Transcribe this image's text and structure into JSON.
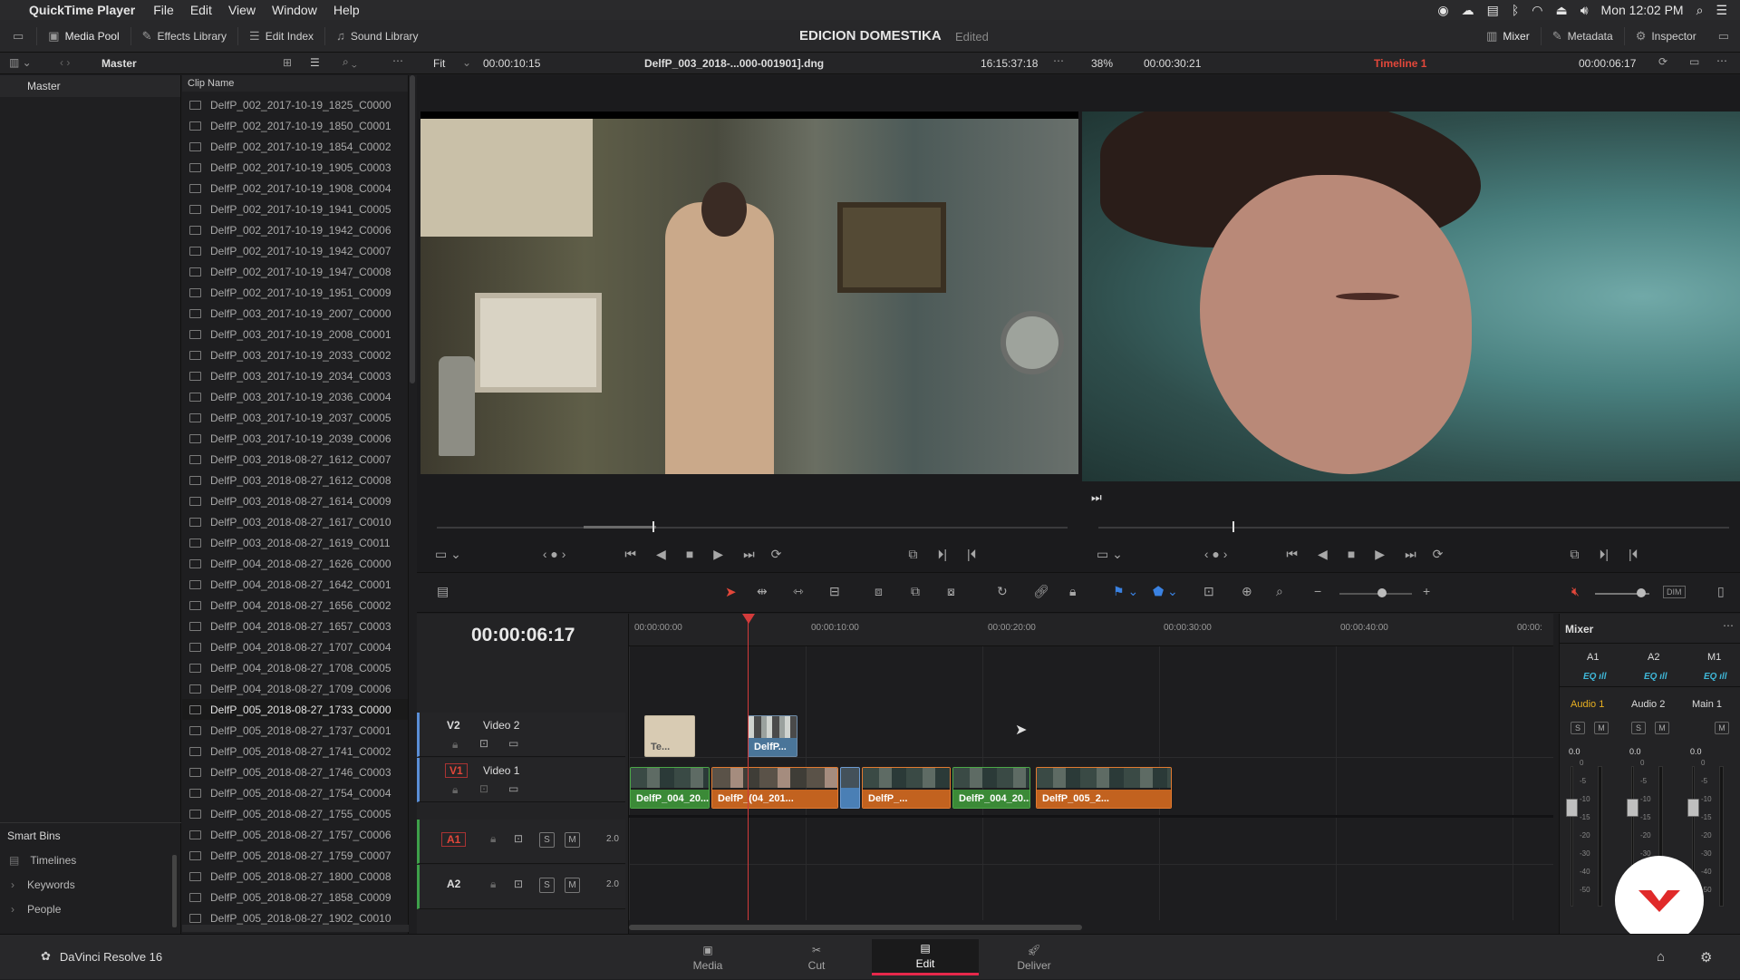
{
  "menubar": {
    "app": "QuickTime Player",
    "items": [
      "File",
      "Edit",
      "View",
      "Window",
      "Help"
    ],
    "clock": "Mon 12:02 PM"
  },
  "toolbar": {
    "media_pool": "Media Pool",
    "effects_library": "Effects Library",
    "edit_index": "Edit Index",
    "sound_library": "Sound Library",
    "project_title": "EDICION DOMESTIKA",
    "project_status": "Edited",
    "mixer": "Mixer",
    "metadata": "Metadata",
    "inspector": "Inspector"
  },
  "subbar": {
    "bin_title": "Master",
    "fit": "Fit",
    "source_tc": "00:00:10:15",
    "clip_name": "DelfP_003_2018-...000-001901].dng",
    "source_time": "16:15:37:18",
    "zoom": "38%",
    "timeline_dur": "00:00:30:21",
    "timeline_name": "Timeline 1",
    "timeline_tc": "00:00:06:17"
  },
  "sidebar": {
    "master": "Master",
    "smart_bins": "Smart Bins",
    "items": [
      "Timelines",
      "Keywords",
      "People"
    ]
  },
  "clip_list": {
    "header": "Clip Name",
    "selected_index": 29,
    "items": [
      "DelfP_002_2017-10-19_1825_C0000",
      "DelfP_002_2017-10-19_1850_C0001",
      "DelfP_002_2017-10-19_1854_C0002",
      "DelfP_002_2017-10-19_1905_C0003",
      "DelfP_002_2017-10-19_1908_C0004",
      "DelfP_002_2017-10-19_1941_C0005",
      "DelfP_002_2017-10-19_1942_C0006",
      "DelfP_002_2017-10-19_1942_C0007",
      "DelfP_002_2017-10-19_1947_C0008",
      "DelfP_002_2017-10-19_1951_C0009",
      "DelfP_003_2017-10-19_2007_C0000",
      "DelfP_003_2017-10-19_2008_C0001",
      "DelfP_003_2017-10-19_2033_C0002",
      "DelfP_003_2017-10-19_2034_C0003",
      "DelfP_003_2017-10-19_2036_C0004",
      "DelfP_003_2017-10-19_2037_C0005",
      "DelfP_003_2017-10-19_2039_C0006",
      "DelfP_003_2018-08-27_1612_C0007",
      "DelfP_003_2018-08-27_1612_C0008",
      "DelfP_003_2018-08-27_1614_C0009",
      "DelfP_003_2018-08-27_1617_C0010",
      "DelfP_003_2018-08-27_1619_C0011",
      "DelfP_004_2018-08-27_1626_C0000",
      "DelfP_004_2018-08-27_1642_C0001",
      "DelfP_004_2018-08-27_1656_C0002",
      "DelfP_004_2018-08-27_1657_C0003",
      "DelfP_004_2018-08-27_1707_C0004",
      "DelfP_004_2018-08-27_1708_C0005",
      "DelfP_004_2018-08-27_1709_C0006",
      "DelfP_005_2018-08-27_1733_C0000",
      "DelfP_005_2018-08-27_1737_C0001",
      "DelfP_005_2018-08-27_1741_C0002",
      "DelfP_005_2018-08-27_1746_C0003",
      "DelfP_005_2018-08-27_1754_C0004",
      "DelfP_005_2018-08-27_1755_C0005",
      "DelfP_005_2018-08-27_1757_C0006",
      "DelfP_005_2018-08-27_1759_C0007",
      "DelfP_005_2018-08-27_1800_C0008",
      "DelfP_005_2018-08-27_1858_C0009",
      "DelfP_005_2018-08-27_1902_C0010"
    ]
  },
  "timeline": {
    "timecode": "00:00:06:17",
    "ruler": [
      "00:00:00:00",
      "00:00:10:00",
      "00:00:20:00",
      "00:00:30:00",
      "00:00:40:00",
      "00:00:"
    ],
    "tracks": {
      "v2": {
        "id": "V2",
        "name": "Video 2"
      },
      "v1": {
        "id": "V1",
        "name": "Video 1"
      },
      "a1": {
        "id": "A1",
        "level": "2.0"
      },
      "a2": {
        "id": "A2",
        "level": "2.0"
      }
    },
    "v2_clips": [
      "Te...",
      "DelfP..."
    ],
    "v1_clips": [
      "DelfP_004_20...",
      "DelfP_(04_201...",
      "DelfP_...",
      "DelfP_004_20...",
      "DelfP_005_2..."
    ],
    "solo": "S",
    "mute": "M"
  },
  "mixer": {
    "title": "Mixer",
    "channels": [
      "A1",
      "A2",
      "M1"
    ],
    "names": [
      "Audio 1",
      "Audio 2",
      "Main 1"
    ],
    "eq": "EQ",
    "gain": [
      "0.0",
      "0.0",
      "0.0"
    ],
    "scale": [
      "0",
      "-5",
      "-10",
      "-15",
      "-20",
      "-30",
      "-40",
      "-50"
    ]
  },
  "bottom": {
    "app_name": "DaVinci Resolve 16",
    "pages": [
      "Media",
      "Cut",
      "Edit",
      "Deliver"
    ],
    "active_page": "Edit"
  },
  "colors": {
    "accent": "#e6284b",
    "playhead": "#d33b3b",
    "clip_green": "#3b8a37",
    "clip_orange": "#c2621f",
    "mixer_yellow": "#e8b021",
    "eq_cyan": "#3fb7d8"
  }
}
